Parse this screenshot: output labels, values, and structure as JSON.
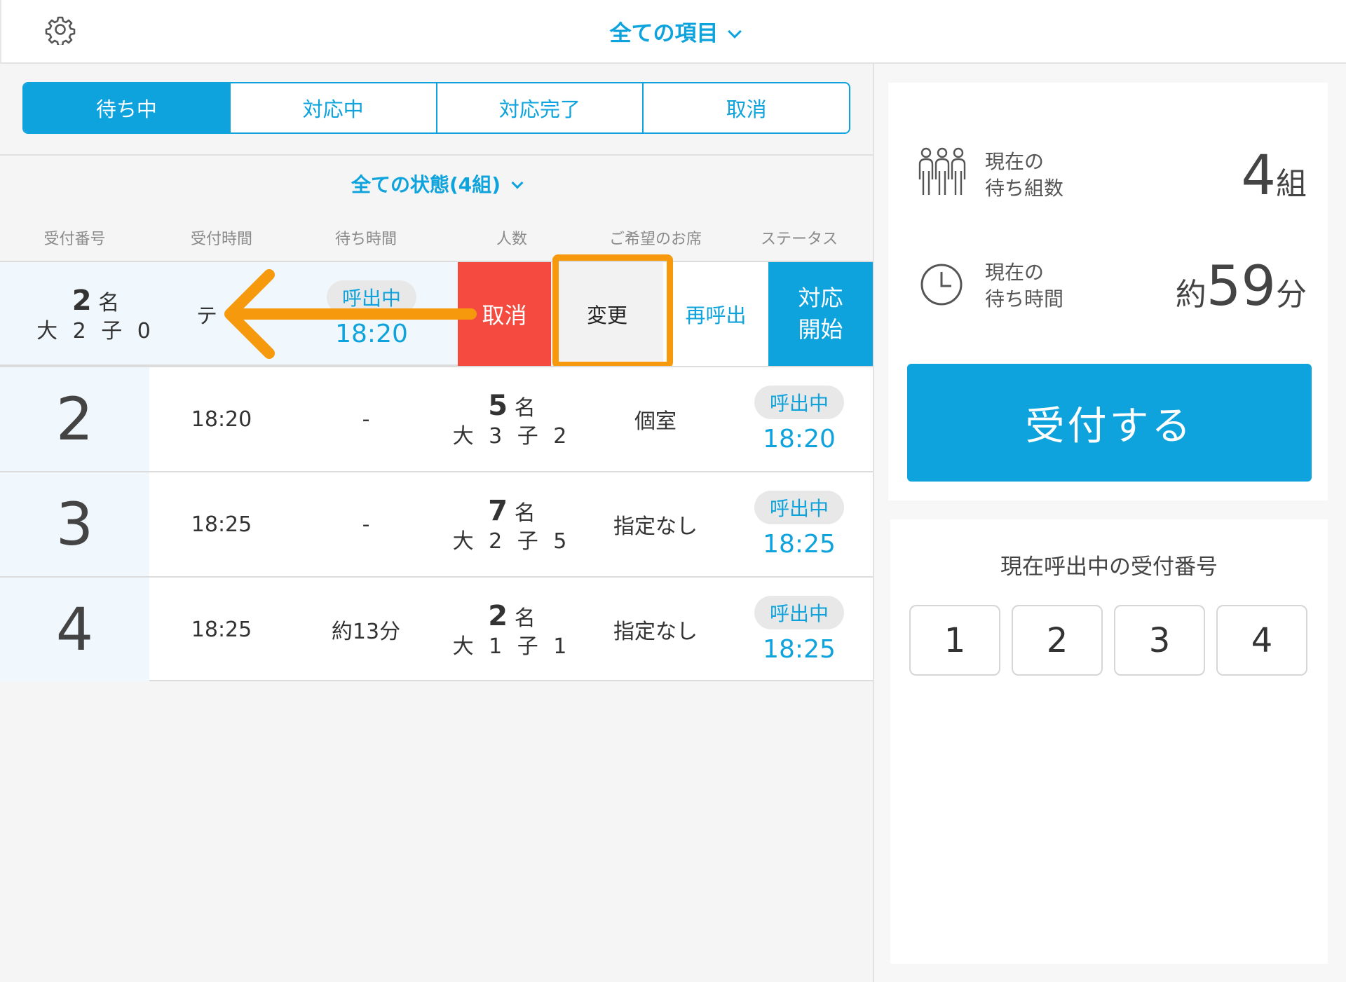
{
  "header": {
    "item_select": "全ての項目"
  },
  "tabs": [
    "待ち中",
    "対応中",
    "対応完了",
    "取消"
  ],
  "state_filter": "全ての状態(4組)",
  "columns": [
    "受付番号",
    "受付時間",
    "待ち時間",
    "人数",
    "ご希望のお席",
    "ステータス"
  ],
  "swiped_row": {
    "people_count": "2",
    "people_unit": "名",
    "people_breakdown": "大 2 子 0",
    "time_partial": "テ",
    "badge": "呼出中",
    "call_time": "18:20",
    "actions": {
      "cancel": "取消",
      "change": "変更",
      "recall": "再呼出",
      "start": "対応\n開始"
    }
  },
  "rows": [
    {
      "number": "2",
      "time": "18:20",
      "wait": "-",
      "people": "5",
      "unit": "名",
      "breakdown": "大 3 子 2",
      "seat": "個室",
      "badge": "呼出中",
      "status_time": "18:20"
    },
    {
      "number": "3",
      "time": "18:25",
      "wait": "-",
      "people": "7",
      "unit": "名",
      "breakdown": "大 2 子 5",
      "seat": "指定なし",
      "badge": "呼出中",
      "status_time": "18:25"
    },
    {
      "number": "4",
      "time": "18:25",
      "wait": "約13分",
      "people": "2",
      "unit": "名",
      "breakdown": "大 1 子 1",
      "seat": "指定なし",
      "badge": "呼出中",
      "status_time": "18:25"
    }
  ],
  "summary": {
    "groups_label": "現在の\n待ち組数",
    "groups_value": "4",
    "groups_unit": "組",
    "wait_label": "現在の\n待ち時間",
    "wait_prefix": "約",
    "wait_value": "59",
    "wait_unit": "分",
    "accept_button": "受付する"
  },
  "calling": {
    "title": "現在呼出中の受付番号",
    "numbers": [
      "1",
      "2",
      "3",
      "4"
    ]
  },
  "colors": {
    "accent": "#0ea3dc",
    "cancel": "#f44a40",
    "highlight": "#f7990c"
  },
  "icons": [
    "gear-icon",
    "chevron-down-icon",
    "people-group-icon",
    "clock-icon",
    "swipe-left-arrow-icon"
  ]
}
